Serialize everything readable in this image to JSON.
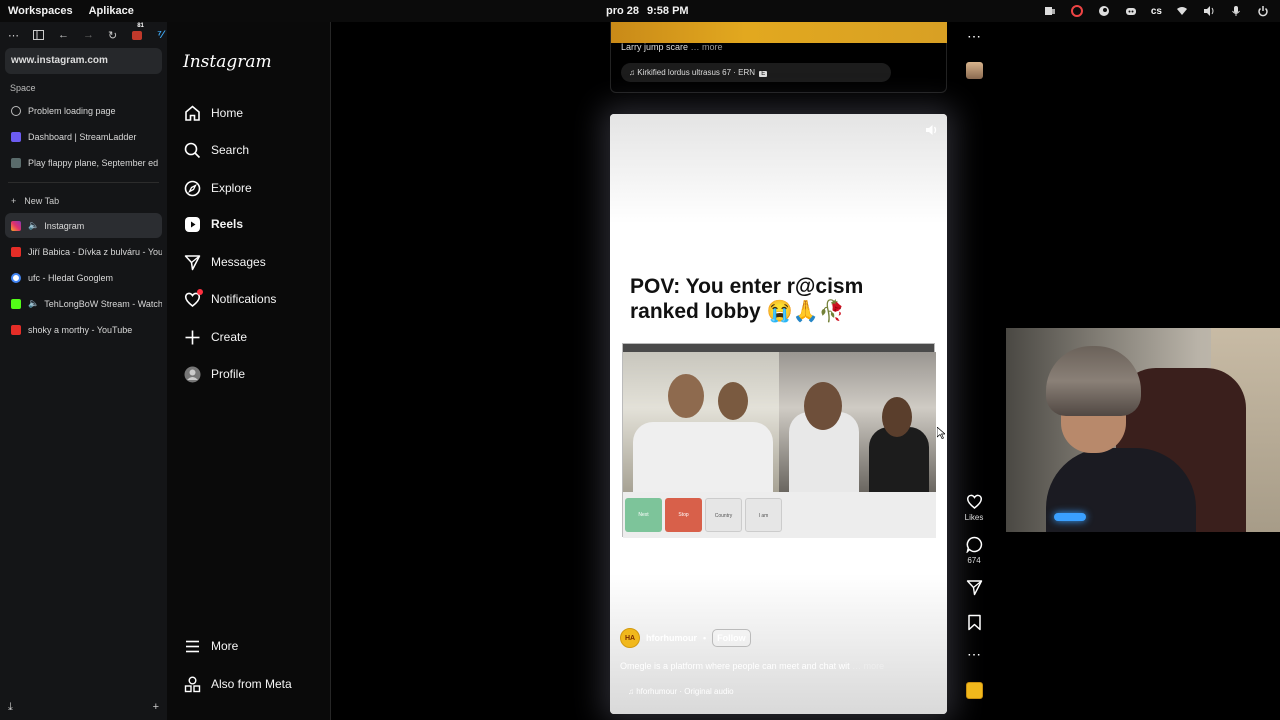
{
  "topbar": {
    "workspaces": "Workspaces",
    "apps": "Aplikace",
    "date": "pro 28",
    "time": "9:58 PM",
    "lang": "cs"
  },
  "browser": {
    "url": "www.instagram.com",
    "space_label": "Space",
    "badge_count": "81",
    "pinned_tabs": [
      {
        "title": "Problem loading page",
        "icon": "info-icon",
        "color": "#888888"
      },
      {
        "title": "Dashboard | StreamLadder",
        "icon": "streamladder-icon",
        "color": "#6c5cf0"
      },
      {
        "title": "Play flappy plane, September ed",
        "icon": "game-icon",
        "color": "#5a6b6b"
      }
    ],
    "new_tab": "New Tab",
    "tabs": [
      {
        "title": "Instagram",
        "icon": "instagram-icon",
        "color": "#e1306c",
        "active": true
      },
      {
        "title": "Jiří Babica - Dívka z bulváru - You",
        "icon": "youtube-icon",
        "color": "#e52d27"
      },
      {
        "title": "ufc - Hledat Googlem",
        "icon": "google-icon",
        "color": "#4285f4"
      },
      {
        "title": "TehLongBoW Stream - Watch",
        "icon": "kick-icon",
        "color": "#53fc18"
      },
      {
        "title": "shoky a morthy - YouTube",
        "icon": "youtube-icon",
        "color": "#e52d27"
      }
    ]
  },
  "ig": {
    "logo": "Instagram",
    "nav": [
      {
        "label": "Home",
        "icon": "home-icon"
      },
      {
        "label": "Search",
        "icon": "search-icon"
      },
      {
        "label": "Explore",
        "icon": "compass-icon"
      },
      {
        "label": "Reels",
        "icon": "reels-icon"
      },
      {
        "label": "Messages",
        "icon": "messages-icon"
      },
      {
        "label": "Notifications",
        "icon": "heart-icon"
      },
      {
        "label": "Create",
        "icon": "plus-icon"
      },
      {
        "label": "Profile",
        "icon": "avatar-icon"
      }
    ],
    "more": "More",
    "meta": "Also from Meta"
  },
  "prev_reel": {
    "caption": "Larry jump scare",
    "more": "… more",
    "audio": "Kirkified lordus ultrasus 67 · ERN",
    "explicit": "E"
  },
  "reel": {
    "title": "POV: You enter r@cism ranked lobby 😭🙏🥀",
    "clip_buttons": [
      "Next",
      "Stop",
      "Country",
      "I am"
    ],
    "author": "hforhumour",
    "author_badge": "HA",
    "follow": "Follow",
    "description": "Omegle is a platform where people can meet and chat wit",
    "more": "… more",
    "audio": "hforhumour · Original audio",
    "likes_label": "Likes",
    "comments_count": "674"
  },
  "colors": {
    "accent_notification": "#ff3040",
    "ig_bg": "#000000",
    "sidebar_bg": "#141517"
  }
}
